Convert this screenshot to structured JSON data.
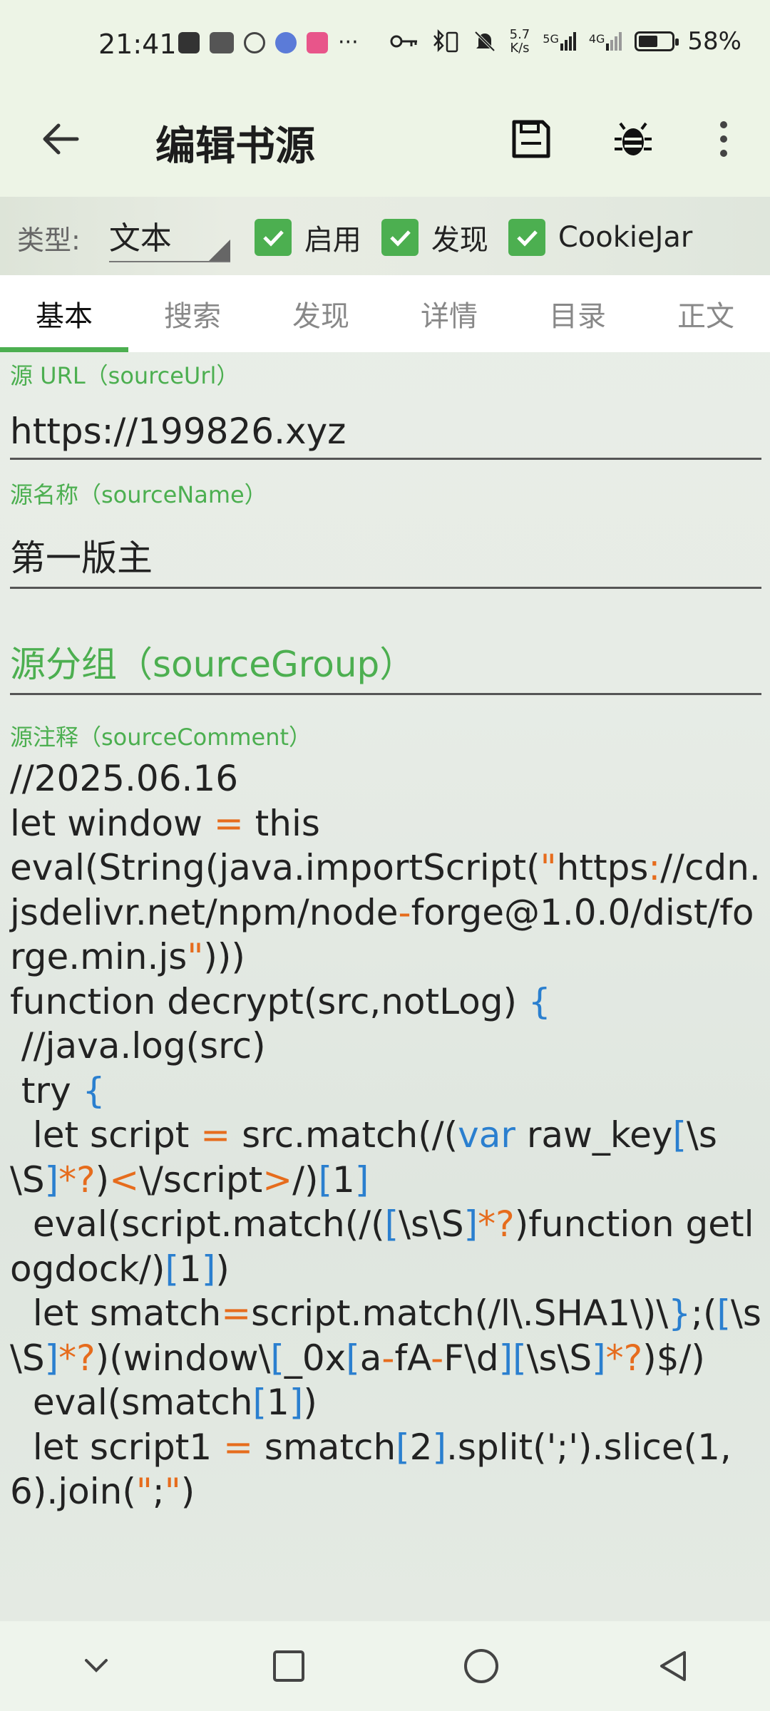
{
  "status_bar": {
    "time": "21:41",
    "net_speed_top": "5.7",
    "net_speed_bottom": "K/s",
    "signal1": "5G",
    "signal2": "4G",
    "battery": "58%",
    "battery_level": 0.58
  },
  "app_bar": {
    "title": "编辑书源",
    "icons": [
      "back-arrow-icon",
      "save-icon",
      "debug-bug-icon",
      "more-vert-icon"
    ]
  },
  "type_row": {
    "label": "类型:",
    "type_value": "文本",
    "checkboxes": [
      {
        "label": "启用",
        "checked": true
      },
      {
        "label": "发现",
        "checked": true
      },
      {
        "label": "CookieJar",
        "checked": true
      }
    ]
  },
  "tabs": [
    "基本",
    "搜索",
    "发现",
    "详情",
    "目录",
    "正文"
  ],
  "active_tab": "基本",
  "fields": {
    "source_url_label": "源 URL（sourceUrl）",
    "source_url_value": "https://199826.xyz",
    "source_name_label": "源名称（sourceName）",
    "source_name_value": "第一版主",
    "source_group_placeholder": "源分组（sourceGroup）",
    "source_comment_label": "源注释（sourceComment）"
  },
  "comment_code": "//2025.06.16\nlet window = this\neval(String(java.importScript(\"https://cdn.jsdelivr.net/npm/node-forge@1.0.0/dist/forge.min.js\")))\nfunction decrypt(src,notLog) {\n //java.log(src)\n try {\n  let script = src.match(/(var raw_key[\\s\\S]*?)<\\/script>/)[1]\n  eval(script.match(/([\\s\\S]*?)function getlogdock/)[1])\n  let smatch=script.match(/l\\.SHA1\\)\\};([\\s\\S]*?)(window\\[_0x[a-fA-F\\d][\\s\\S]*?)$/)\n  eval(smatch[1])\n  let script1 = smatch[2].split(';').slice(1,6).join(\";\")",
  "accent_color": "#4caf50",
  "nav_bar": [
    "hide-keyboard-icon",
    "recents-icon",
    "home-icon",
    "back-icon"
  ]
}
